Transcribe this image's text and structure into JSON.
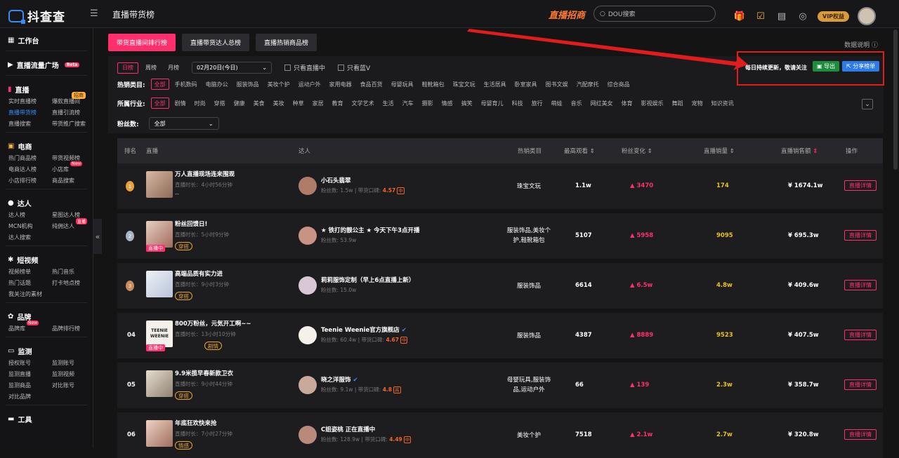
{
  "app": {
    "logo_text": "抖查查",
    "page_title": "直播带货榜",
    "promo": "直播招商",
    "search_placeholder": "DOU搜索",
    "vip_label": "VIP权益"
  },
  "sidebar": {
    "sections": [
      {
        "title": "工作台",
        "items": []
      },
      {
        "title": "直播流量广场",
        "badge": "Beta",
        "items": []
      },
      {
        "title": "直播",
        "items": [
          "实时直播榜",
          "爆款直播间",
          "直播带货榜",
          "直播引流榜",
          "直播搜索",
          "带货推广搜索"
        ],
        "tag": "招商"
      },
      {
        "title": "电商",
        "items": [
          "热门商品榜",
          "带货视频榜",
          "电商达人榜",
          "小店库",
          "小店排行榜",
          "商品搜索"
        ],
        "tag": "New"
      },
      {
        "title": "达人",
        "items": [
          "达人榜",
          "星图达人榜",
          "MCN机构",
          "纯佣达人",
          "达人搜索"
        ],
        "tag": "直播"
      },
      {
        "title": "短视频",
        "items": [
          "视频榜单",
          "热门音乐",
          "热门话题",
          "打卡地点榜",
          "我关注的素材"
        ]
      },
      {
        "title": "品牌",
        "items": [
          "品牌库",
          "品牌排行榜"
        ],
        "tag": "New"
      },
      {
        "title": "监测",
        "items": [
          "授权账号",
          "监测账号",
          "监测直播",
          "监测视频",
          "监测商品",
          "对比账号",
          "对比品牌"
        ]
      },
      {
        "title": "工具",
        "items": []
      }
    ]
  },
  "tabs": [
    "带货直播间排行榜",
    "直播带货达人总榜",
    "直播热销商品榜"
  ],
  "explain": "数据说明",
  "filters": {
    "periods": [
      "日榜",
      "周榜",
      "月榜"
    ],
    "date": "02月20日(今日)",
    "only_live": "只看直播中",
    "only_blue": "只看蓝V",
    "hot_label": "热销类目:",
    "hot_cats": [
      "全部",
      "手机数码",
      "电脑办公",
      "服装饰品",
      "美妆个护",
      "运动户外",
      "家用电器",
      "食品百货",
      "母婴玩具",
      "鞋靴箱包",
      "珠宝文玩",
      "生活居具",
      "卧室家具",
      "图书文娱",
      "汽配摩托",
      "综合商品"
    ],
    "industry_label": "所属行业:",
    "industries": [
      "全部",
      "剧情",
      "时尚",
      "穿搭",
      "健康",
      "美食",
      "美妆",
      "种草",
      "家居",
      "教育",
      "文学艺术",
      "生活",
      "汽车",
      "摄影",
      "情感",
      "搞笑",
      "母婴育儿",
      "科技",
      "旅行",
      "萌娃",
      "音乐",
      "网红美女",
      "体育",
      "影视娱乐",
      "舞蹈",
      "宠物",
      "知识资讯"
    ],
    "fans_label": "粉丝数:",
    "fans_value": "全部"
  },
  "notice": {
    "text": "每日持续更新，敬请关注",
    "export": "导出",
    "share": "分享榜单"
  },
  "table": {
    "headers": [
      "排名",
      "直播",
      "达人",
      "热销类目",
      "最高观看",
      "粉丝变化",
      "直播销量",
      "直播销售额",
      "操作"
    ],
    "rows": [
      {
        "rank": "1",
        "title": "万人直播现场连来围观",
        "duration": "直播时长：4小时56分钟",
        "extra": "--",
        "tag": "",
        "live": "",
        "name": "小石头翡翠",
        "fans": "粉丝数: 1.5w",
        "score": "4.57",
        "level": "中",
        "category": "珠宝文玩",
        "max_view": "1.1w",
        "fans_change": "3470",
        "sales": "174",
        "amount": "¥ 1674.1w",
        "action": "直播详情"
      },
      {
        "rank": "2",
        "title": "粉丝回馈日!",
        "duration": "直播时长：5小时9分钟",
        "extra": "",
        "tag": "穿搭",
        "live": "直播中",
        "name": "★ 铁打的靓公主 ★ 今天下午3点开播",
        "fans": "粉丝数: 53.9w",
        "score": "",
        "level": "",
        "category": "服装饰品,美妆个护,鞋靴箱包",
        "max_view": "5107",
        "fans_change": "5958",
        "sales": "9095",
        "amount": "¥ 695.3w",
        "action": "直播详情"
      },
      {
        "rank": "3",
        "title": "高端品质有实力进",
        "duration": "直播时长：9小时3分钟",
        "extra": "",
        "tag": "穿搭",
        "live": "",
        "name": "莉莉服饰定制（早上6点直播上新）",
        "fans": "粉丝数: 15.0w",
        "score": "",
        "level": "",
        "category": "服装饰品",
        "max_view": "6614",
        "fans_change": "6.5w",
        "sales": "4.8w",
        "amount": "¥ 409.6w",
        "action": "直播详情"
      },
      {
        "rank": "04",
        "title": "800万粉丝，元気开工啊~~",
        "duration": "直播时长：13小时10分钟",
        "extra": "",
        "tag": "剧情",
        "live": "直播中",
        "name": "Teenie Weenie官方旗舰店",
        "fans": "粉丝数: 60.4w",
        "score": "4.67",
        "level": "中",
        "category": "服装饰品",
        "max_view": "4387",
        "fans_change": "8889",
        "sales": "9523",
        "amount": "¥ 407.5w",
        "action": "直播详情"
      },
      {
        "rank": "05",
        "title": "9.9米揽早春新款卫衣",
        "duration": "直播时长：9小时44分钟",
        "extra": "",
        "tag": "穿搭",
        "live": "",
        "name": "晓之洋服饰",
        "fans": "粉丝数: 9.1w",
        "score": "4.8",
        "level": "高",
        "category": "母婴玩具,服装饰品,运动户外",
        "max_view": "66",
        "fans_change": "139",
        "sales": "2.3w",
        "amount": "¥ 358.7w",
        "action": "直播详情"
      },
      {
        "rank": "06",
        "title": "年底狂欢快来抢",
        "duration": "直播时长：7小时27分钟",
        "extra": "",
        "tag": "情感",
        "live": "",
        "name": "C姐姿桃 正在直播中",
        "fans": "粉丝数: 128.9w",
        "score": "4.49",
        "level": "中",
        "category": "美妆个护",
        "max_view": "7518",
        "fans_change": "2.1w",
        "sales": "2.7w",
        "amount": "¥ 320.8w",
        "action": "直播详情"
      }
    ]
  },
  "colors": {
    "accent": "#ff2f6d",
    "blue": "#3a8cf5",
    "gold": "#e8c21a",
    "annotation": "#e01c1c"
  }
}
